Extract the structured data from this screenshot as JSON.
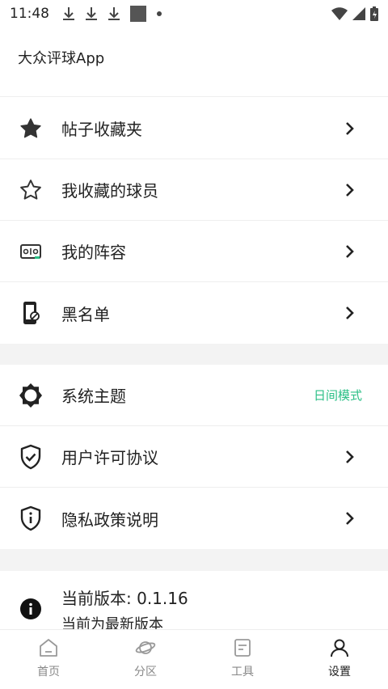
{
  "status_bar": {
    "time": "11:48",
    "left_icons": [
      "download-icon",
      "download-icon",
      "download-icon",
      "image-icon",
      "dot-icon"
    ],
    "right_icons": [
      "wifi-icon",
      "signal-icon",
      "battery-icon"
    ]
  },
  "header": {
    "title": "大众评球App"
  },
  "group1": [
    {
      "label": "帖子收藏夹",
      "icon": "star-filled-icon"
    },
    {
      "label": "我收藏的球员",
      "icon": "star-outline-icon"
    },
    {
      "label": "我的阵容",
      "icon": "lineup-icon"
    },
    {
      "label": "黑名单",
      "icon": "blocked-phone-icon"
    }
  ],
  "group2": [
    {
      "label": "系统主题",
      "icon": "theme-icon",
      "value": "日间模式"
    },
    {
      "label": "用户许可协议",
      "icon": "shield-check-icon"
    },
    {
      "label": "隐私政策说明",
      "icon": "shield-info-icon"
    }
  ],
  "version": {
    "title": "当前版本: 0.1.16",
    "subtitle": "当前为最新版本",
    "icon": "info-icon"
  },
  "bottom_nav": [
    {
      "label": "首页",
      "icon": "home-icon",
      "active": false
    },
    {
      "label": "分区",
      "icon": "planet-icon",
      "active": false
    },
    {
      "label": "工具",
      "icon": "tools-icon",
      "active": false
    },
    {
      "label": "设置",
      "icon": "profile-icon",
      "active": true
    }
  ],
  "colors": {
    "accent": "#2bbf86",
    "text": "#222222",
    "muted": "#888888",
    "divider": "#f3f3f3"
  }
}
